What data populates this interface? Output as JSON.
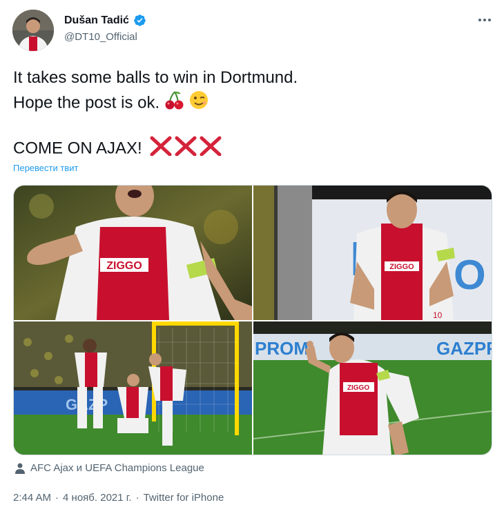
{
  "author": {
    "display_name": "Dušan Tadić",
    "handle": "@DT10_Official",
    "verified": true
  },
  "tweet": {
    "line1": "It takes some balls to win in Dortmund.",
    "line2": "Hope the post is ok.",
    "line3": "COME ON AJAX!",
    "emojis": [
      "cherries-emoji",
      "winking-face-emoji"
    ],
    "cross_marks": 3,
    "translate_label": "Перевести твит"
  },
  "media": {
    "count": 4,
    "subjects": [
      "player-celebrating-closeup",
      "player-smiling-near-goalpost",
      "team-on-pitch-near-goal",
      "player-celebrating-pointing"
    ]
  },
  "tagged": {
    "label": "AFC Ajax и UEFA Champions League"
  },
  "meta": {
    "time": "2:44 AM",
    "date": "4 нояб. 2021 г.",
    "source": "Twitter for iPhone"
  },
  "colors": {
    "accent_blue": "#1d9bf0",
    "secondary_text": "#536471",
    "cross_red": "#d4233a"
  }
}
